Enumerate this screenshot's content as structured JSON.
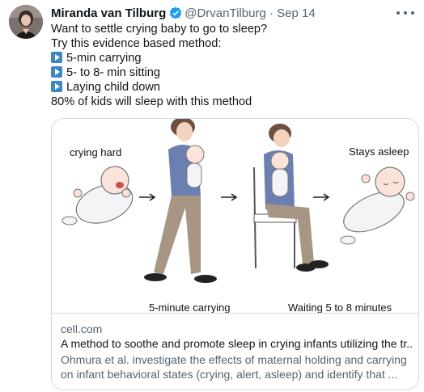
{
  "tweet": {
    "author_name": "Miranda van Tilburg",
    "handle": "@DrvanTilburg",
    "separator": "·",
    "date": "Sep 14",
    "lines": [
      "Want to settle crying baby to go to sleep?",
      "Try this evidence based method:",
      "5-min carrying",
      "5- to 8- min sitting",
      "Laying child down",
      "80% of kids will sleep with this method"
    ]
  },
  "card": {
    "figure": {
      "label_crying": "crying hard",
      "label_asleep": "Stays asleep",
      "caption_carrying": "5-minute carrying",
      "caption_waiting": "Waiting 5 to 8 minutes"
    },
    "domain": "cell.com",
    "title": "A method to soothe and promote sleep in crying infants utilizing the tr...",
    "description": "Ohmura et al. investigate the effects of maternal holding and carrying on infant behavioral states (crying, alert, asleep) and identify that ..."
  },
  "icons": {
    "verified": "verified-badge-icon",
    "bullet": "play-button-emoji-icon",
    "more": "more-options-icon"
  },
  "colors": {
    "verified_blue": "#1d9bf0",
    "emoji_blue": "#3b88c3",
    "secondary_text": "#536471",
    "border": "#cfd9de"
  }
}
